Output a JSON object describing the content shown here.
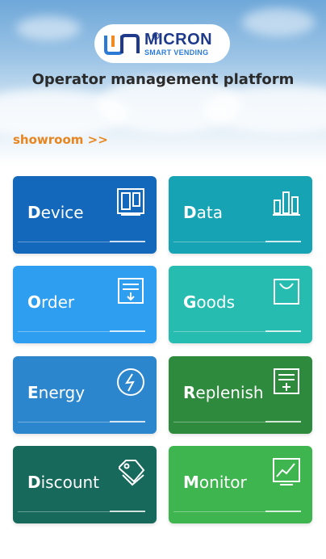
{
  "brand": {
    "name": "MICRON",
    "tagline": "SMART VENDING",
    "registered": "®"
  },
  "header": {
    "title": "Operator management platform"
  },
  "showroom_link": "showroom >>",
  "tiles": [
    {
      "initial": "D",
      "rest": "evice",
      "color": "#1368bc",
      "icon": "device-icon"
    },
    {
      "initial": "D",
      "rest": "ata",
      "color": "#16a3b4",
      "icon": "bar-chart-icon"
    },
    {
      "initial": "O",
      "rest": "rder",
      "color": "#2e9ef1",
      "icon": "order-document-icon"
    },
    {
      "initial": "G",
      "rest": "oods",
      "color": "#26bcb0",
      "icon": "goods-bag-icon"
    },
    {
      "initial": "E",
      "rest": "nergy",
      "color": "#2c86cd",
      "icon": "energy-icon"
    },
    {
      "initial": "R",
      "rest": "eplenish",
      "color": "#2e8a3c",
      "icon": "replenish-icon"
    },
    {
      "initial": "D",
      "rest": "iscount",
      "color": "#17695c",
      "icon": "discount-tag-icon"
    },
    {
      "initial": "M",
      "rest": "onitor",
      "color": "#3fb54f",
      "icon": "monitor-chart-icon"
    }
  ]
}
